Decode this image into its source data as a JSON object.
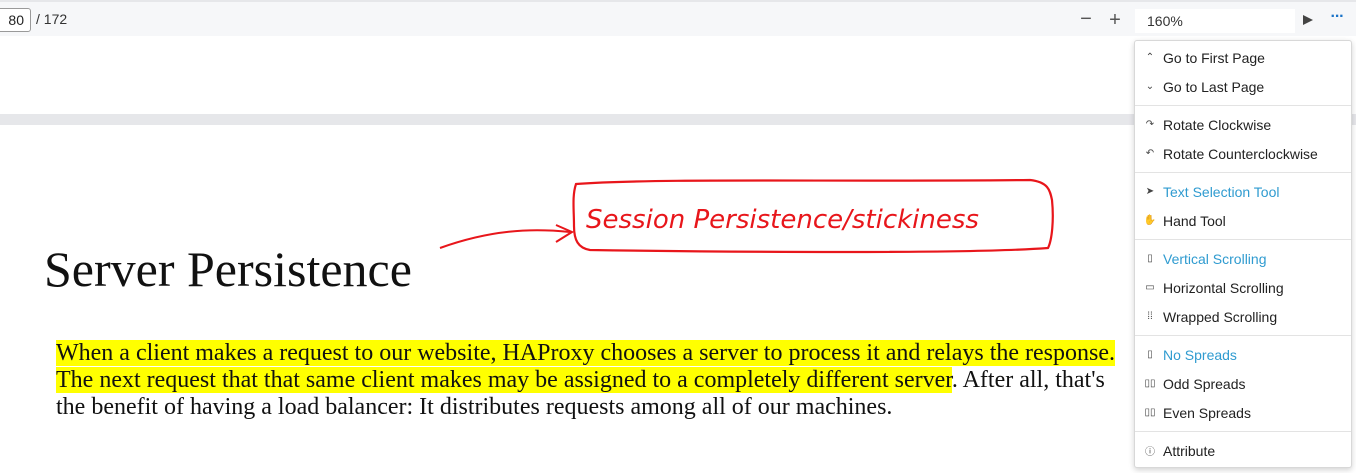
{
  "toolbar": {
    "page_number": "80",
    "page_total": "/ 172",
    "zoom_out": "−",
    "zoom_in": "+",
    "zoom_level": "160%",
    "more": "···"
  },
  "document": {
    "heading": "Server Persistence",
    "paragraph_highlighted_1": "When a client makes a request to our website, HAProxy chooses a server to process it and relays the response. The next request that that same client makes may be assigned to a completely different server",
    "paragraph_rest": ". After all, that's the benefit of having a load balancer: It distributes requests among all of our machines.",
    "annotation": "Session Persistence/stickiness",
    "highlight_color": "#ffff00",
    "annotation_color": "#e8161b"
  },
  "menu": {
    "items": [
      {
        "label": "Go to First Page",
        "icon": "chevron-up-icon",
        "glyph": "⌃"
      },
      {
        "label": "Go to Last Page",
        "icon": "chevron-down-icon",
        "glyph": "⌄"
      },
      {
        "label": "Rotate Clockwise",
        "icon": "rotate-cw-icon",
        "glyph": "↷"
      },
      {
        "label": "Rotate Counterclockwise",
        "icon": "rotate-ccw-icon",
        "glyph": "↶"
      },
      {
        "label": "Text Selection Tool",
        "icon": "cursor-icon",
        "glyph": "➤"
      },
      {
        "label": "Hand Tool",
        "icon": "hand-icon",
        "glyph": "✋"
      },
      {
        "label": "Vertical Scrolling",
        "icon": "vertical-scroll-icon",
        "glyph": "▯"
      },
      {
        "label": "Horizontal Scrolling",
        "icon": "horizontal-scroll-icon",
        "glyph": "▭"
      },
      {
        "label": "Wrapped Scrolling",
        "icon": "wrapped-scroll-icon",
        "glyph": "⁞⁞"
      },
      {
        "label": "No Spreads",
        "icon": "no-spreads-icon",
        "glyph": "▯"
      },
      {
        "label": "Odd Spreads",
        "icon": "odd-spreads-icon",
        "glyph": "▯▯"
      },
      {
        "label": "Even Spreads",
        "icon": "even-spreads-icon",
        "glyph": "▯▯"
      },
      {
        "label": "Attribute",
        "icon": "info-icon",
        "glyph": "ⓘ"
      }
    ],
    "active_color": "#2f9bd0"
  }
}
